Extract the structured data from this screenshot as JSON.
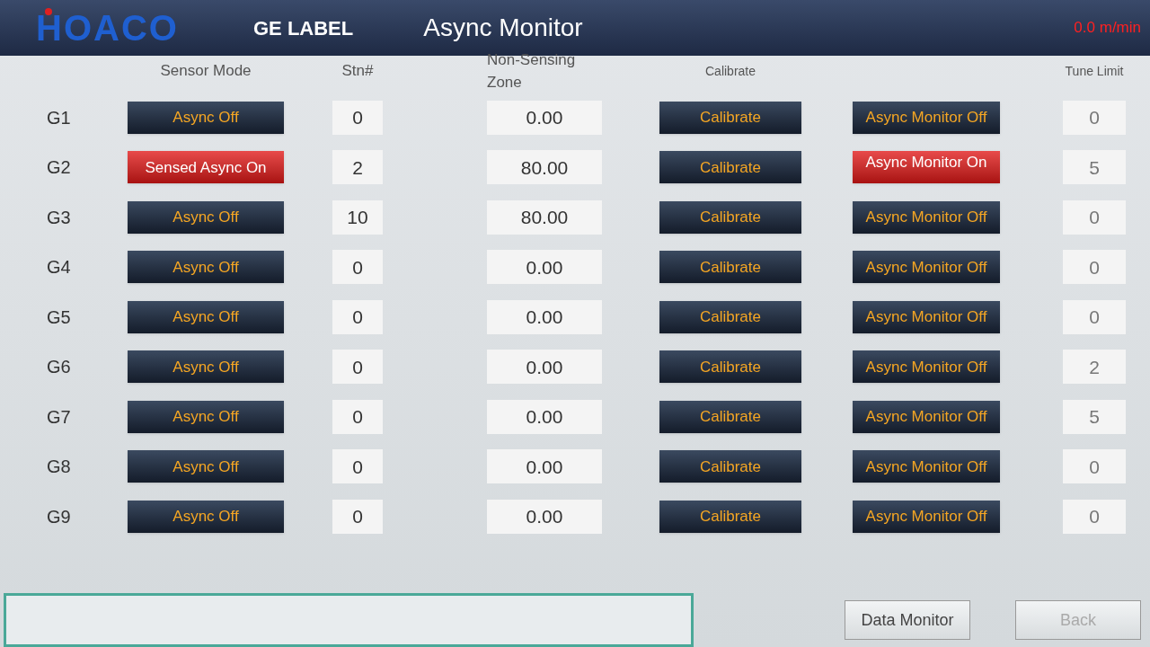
{
  "header": {
    "logo": "HOACO",
    "product": "GE LABEL",
    "title": "Async Monitor",
    "speed": "0.0 m/min"
  },
  "columns": {
    "sensor_mode": "Sensor Mode",
    "stn": "Stn#",
    "zone": "Non-Sensing Zone",
    "calibrate": "Calibrate",
    "tune_limit": "Tune Limit"
  },
  "rows": [
    {
      "label": "G1",
      "sensor_mode": {
        "label": "Async Off",
        "on": false
      },
      "stn": "0",
      "zone": "0.00",
      "calibrate": "Calibrate",
      "monitor": {
        "label": "Async Monitor Off",
        "on": false
      },
      "tune_limit": "0"
    },
    {
      "label": "G2",
      "sensor_mode": {
        "label": "Sensed Async On",
        "on": true
      },
      "stn": "2",
      "zone": "80.00",
      "calibrate": "Calibrate",
      "monitor": {
        "label": "Async Monitor On",
        "on": true
      },
      "tune_limit": "5"
    },
    {
      "label": "G3",
      "sensor_mode": {
        "label": "Async Off",
        "on": false
      },
      "stn": "10",
      "zone": "80.00",
      "calibrate": "Calibrate",
      "monitor": {
        "label": "Async Monitor Off",
        "on": false
      },
      "tune_limit": "0"
    },
    {
      "label": "G4",
      "sensor_mode": {
        "label": "Async Off",
        "on": false
      },
      "stn": "0",
      "zone": "0.00",
      "calibrate": "Calibrate",
      "monitor": {
        "label": "Async Monitor Off",
        "on": false
      },
      "tune_limit": "0"
    },
    {
      "label": "G5",
      "sensor_mode": {
        "label": "Async Off",
        "on": false
      },
      "stn": "0",
      "zone": "0.00",
      "calibrate": "Calibrate",
      "monitor": {
        "label": "Async Monitor Off",
        "on": false
      },
      "tune_limit": "0"
    },
    {
      "label": "G6",
      "sensor_mode": {
        "label": "Async Off",
        "on": false
      },
      "stn": "0",
      "zone": "0.00",
      "calibrate": "Calibrate",
      "monitor": {
        "label": "Async Monitor Off",
        "on": false
      },
      "tune_limit": "2"
    },
    {
      "label": "G7",
      "sensor_mode": {
        "label": "Async Off",
        "on": false
      },
      "stn": "0",
      "zone": "0.00",
      "calibrate": "Calibrate",
      "monitor": {
        "label": "Async Monitor Off",
        "on": false
      },
      "tune_limit": "5"
    },
    {
      "label": "G8",
      "sensor_mode": {
        "label": "Async Off",
        "on": false
      },
      "stn": "0",
      "zone": "0.00",
      "calibrate": "Calibrate",
      "monitor": {
        "label": "Async Monitor Off",
        "on": false
      },
      "tune_limit": "0"
    },
    {
      "label": "G9",
      "sensor_mode": {
        "label": "Async Off",
        "on": false
      },
      "stn": "0",
      "zone": "0.00",
      "calibrate": "Calibrate",
      "monitor": {
        "label": "Async Monitor Off",
        "on": false
      },
      "tune_limit": "0"
    }
  ],
  "footer": {
    "buttons": [
      {
        "label": "Data Monitor",
        "disabled": false
      },
      {
        "label": "Back",
        "disabled": true
      }
    ]
  }
}
